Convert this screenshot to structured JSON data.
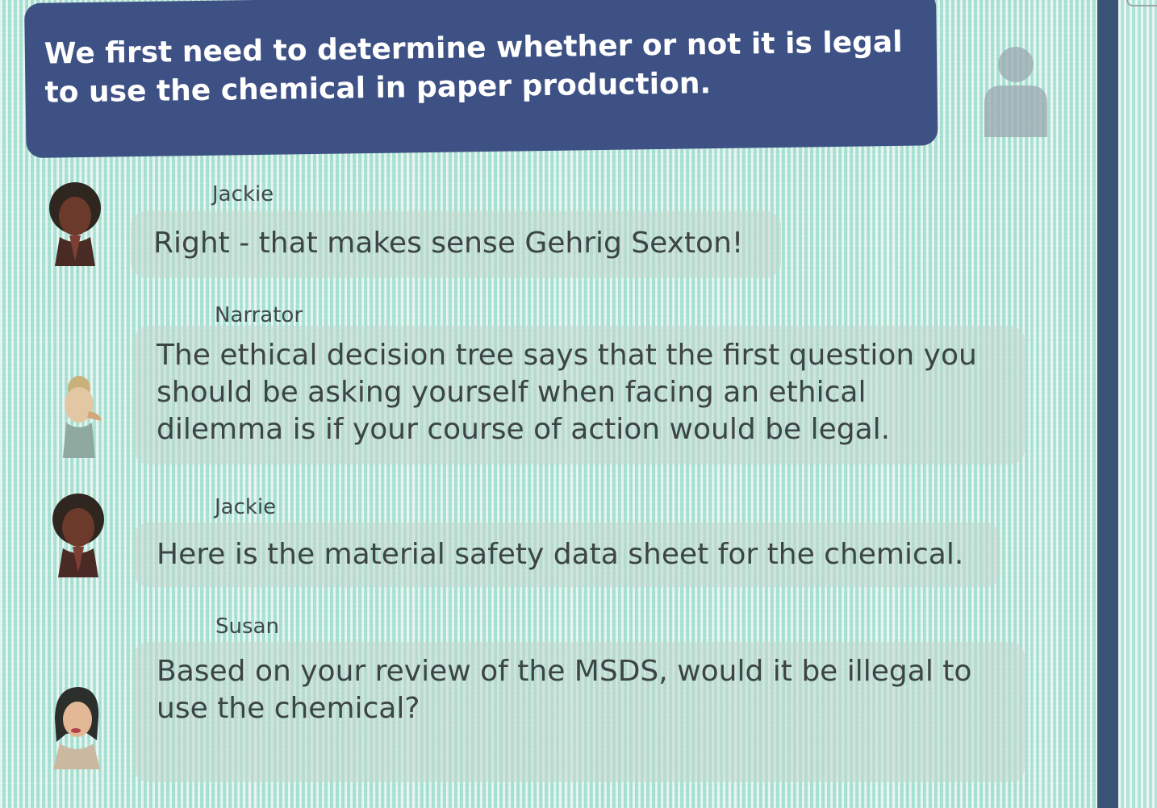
{
  "user_message": {
    "text": "We first need to determine whether or not it is legal to use the chemical in paper production."
  },
  "messages": [
    {
      "speaker": "Jackie",
      "text": "Right - that makes sense Gehrig Sexton!",
      "avatar": "jackie-avatar"
    },
    {
      "speaker": "Narrator",
      "text": "The ethical decision tree says that the first question you should be asking yourself when facing an ethical dilemma is if your course of action would be legal.",
      "avatar": "narrator-avatar"
    },
    {
      "speaker": "Jackie",
      "text": "Here is the material safety data sheet for the chemical.",
      "avatar": "jackie-avatar"
    },
    {
      "speaker": "Susan",
      "text": "Based on your review of the MSDS, would it be illegal to use the chemical?",
      "avatar": "susan-avatar"
    }
  ],
  "colors": {
    "user_bubble": "#3e5184",
    "side_strip": "#3a5478",
    "bubble_text": "#3c4545"
  }
}
